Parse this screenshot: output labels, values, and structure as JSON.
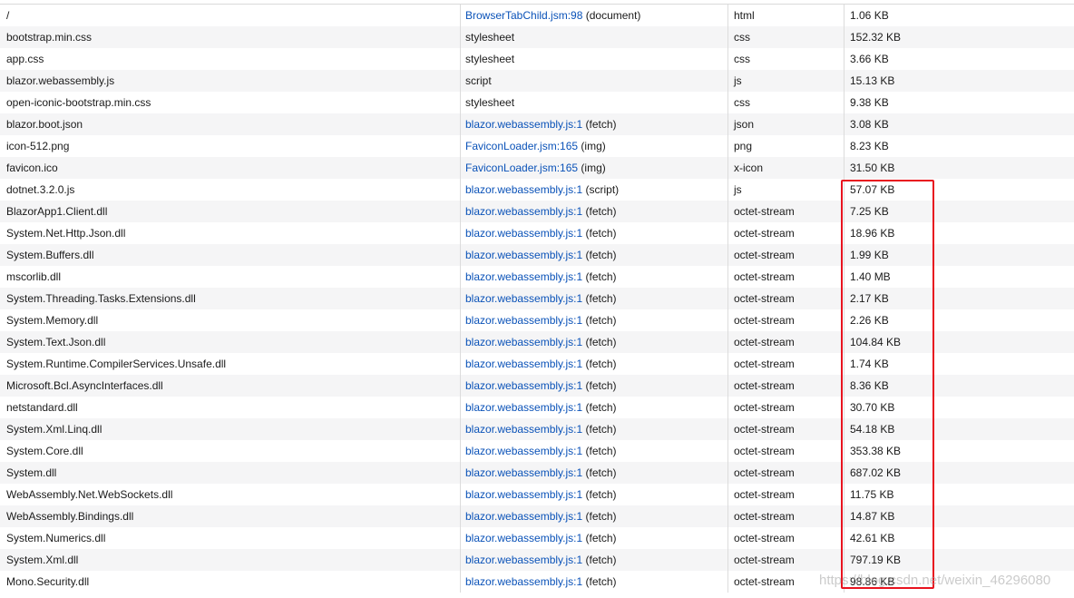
{
  "requests": [
    {
      "file": "/",
      "cause_link": "BrowserTabChild.jsm:98",
      "cause_type": "(document)",
      "type": "html",
      "size": "1.06 KB"
    },
    {
      "file": "bootstrap.min.css",
      "cause_link": "",
      "cause_type": "stylesheet",
      "type": "css",
      "size": "152.32 KB"
    },
    {
      "file": "app.css",
      "cause_link": "",
      "cause_type": "stylesheet",
      "type": "css",
      "size": "3.66 KB"
    },
    {
      "file": "blazor.webassembly.js",
      "cause_link": "",
      "cause_type": "script",
      "type": "js",
      "size": "15.13 KB"
    },
    {
      "file": "open-iconic-bootstrap.min.css",
      "cause_link": "",
      "cause_type": "stylesheet",
      "type": "css",
      "size": "9.38 KB"
    },
    {
      "file": "blazor.boot.json",
      "cause_link": "blazor.webassembly.js:1",
      "cause_type": "(fetch)",
      "type": "json",
      "size": "3.08 KB"
    },
    {
      "file": "icon-512.png",
      "cause_link": "FaviconLoader.jsm:165",
      "cause_type": "(img)",
      "type": "png",
      "size": "8.23 KB"
    },
    {
      "file": "favicon.ico",
      "cause_link": "FaviconLoader.jsm:165",
      "cause_type": "(img)",
      "type": "x-icon",
      "size": "31.50 KB"
    },
    {
      "file": "dotnet.3.2.0.js",
      "cause_link": "blazor.webassembly.js:1",
      "cause_type": "(script)",
      "type": "js",
      "size": "57.07 KB"
    },
    {
      "file": "BlazorApp1.Client.dll",
      "cause_link": "blazor.webassembly.js:1",
      "cause_type": "(fetch)",
      "type": "octet-stream",
      "size": "7.25 KB"
    },
    {
      "file": "System.Net.Http.Json.dll",
      "cause_link": "blazor.webassembly.js:1",
      "cause_type": "(fetch)",
      "type": "octet-stream",
      "size": "18.96 KB"
    },
    {
      "file": "System.Buffers.dll",
      "cause_link": "blazor.webassembly.js:1",
      "cause_type": "(fetch)",
      "type": "octet-stream",
      "size": "1.99 KB"
    },
    {
      "file": "mscorlib.dll",
      "cause_link": "blazor.webassembly.js:1",
      "cause_type": "(fetch)",
      "type": "octet-stream",
      "size": "1.40 MB"
    },
    {
      "file": "System.Threading.Tasks.Extensions.dll",
      "cause_link": "blazor.webassembly.js:1",
      "cause_type": "(fetch)",
      "type": "octet-stream",
      "size": "2.17 KB"
    },
    {
      "file": "System.Memory.dll",
      "cause_link": "blazor.webassembly.js:1",
      "cause_type": "(fetch)",
      "type": "octet-stream",
      "size": "2.26 KB"
    },
    {
      "file": "System.Text.Json.dll",
      "cause_link": "blazor.webassembly.js:1",
      "cause_type": "(fetch)",
      "type": "octet-stream",
      "size": "104.84 KB"
    },
    {
      "file": "System.Runtime.CompilerServices.Unsafe.dll",
      "cause_link": "blazor.webassembly.js:1",
      "cause_type": "(fetch)",
      "type": "octet-stream",
      "size": "1.74 KB"
    },
    {
      "file": "Microsoft.Bcl.AsyncInterfaces.dll",
      "cause_link": "blazor.webassembly.js:1",
      "cause_type": "(fetch)",
      "type": "octet-stream",
      "size": "8.36 KB"
    },
    {
      "file": "netstandard.dll",
      "cause_link": "blazor.webassembly.js:1",
      "cause_type": "(fetch)",
      "type": "octet-stream",
      "size": "30.70 KB"
    },
    {
      "file": "System.Xml.Linq.dll",
      "cause_link": "blazor.webassembly.js:1",
      "cause_type": "(fetch)",
      "type": "octet-stream",
      "size": "54.18 KB"
    },
    {
      "file": "System.Core.dll",
      "cause_link": "blazor.webassembly.js:1",
      "cause_type": "(fetch)",
      "type": "octet-stream",
      "size": "353.38 KB"
    },
    {
      "file": "System.dll",
      "cause_link": "blazor.webassembly.js:1",
      "cause_type": "(fetch)",
      "type": "octet-stream",
      "size": "687.02 KB"
    },
    {
      "file": "WebAssembly.Net.WebSockets.dll",
      "cause_link": "blazor.webassembly.js:1",
      "cause_type": "(fetch)",
      "type": "octet-stream",
      "size": "11.75 KB"
    },
    {
      "file": "WebAssembly.Bindings.dll",
      "cause_link": "blazor.webassembly.js:1",
      "cause_type": "(fetch)",
      "type": "octet-stream",
      "size": "14.87 KB"
    },
    {
      "file": "System.Numerics.dll",
      "cause_link": "blazor.webassembly.js:1",
      "cause_type": "(fetch)",
      "type": "octet-stream",
      "size": "42.61 KB"
    },
    {
      "file": "System.Xml.dll",
      "cause_link": "blazor.webassembly.js:1",
      "cause_type": "(fetch)",
      "type": "octet-stream",
      "size": "797.19 KB"
    },
    {
      "file": "Mono.Security.dll",
      "cause_link": "blazor.webassembly.js:1",
      "cause_type": "(fetch)",
      "type": "octet-stream",
      "size": "98.86 KB"
    }
  ],
  "watermark": "https://blog.csdn.net/weixin_46296080",
  "colors": {
    "link": "#0a52b8",
    "highlight": "#e8131f",
    "alt_row": "#f5f5f6"
  }
}
